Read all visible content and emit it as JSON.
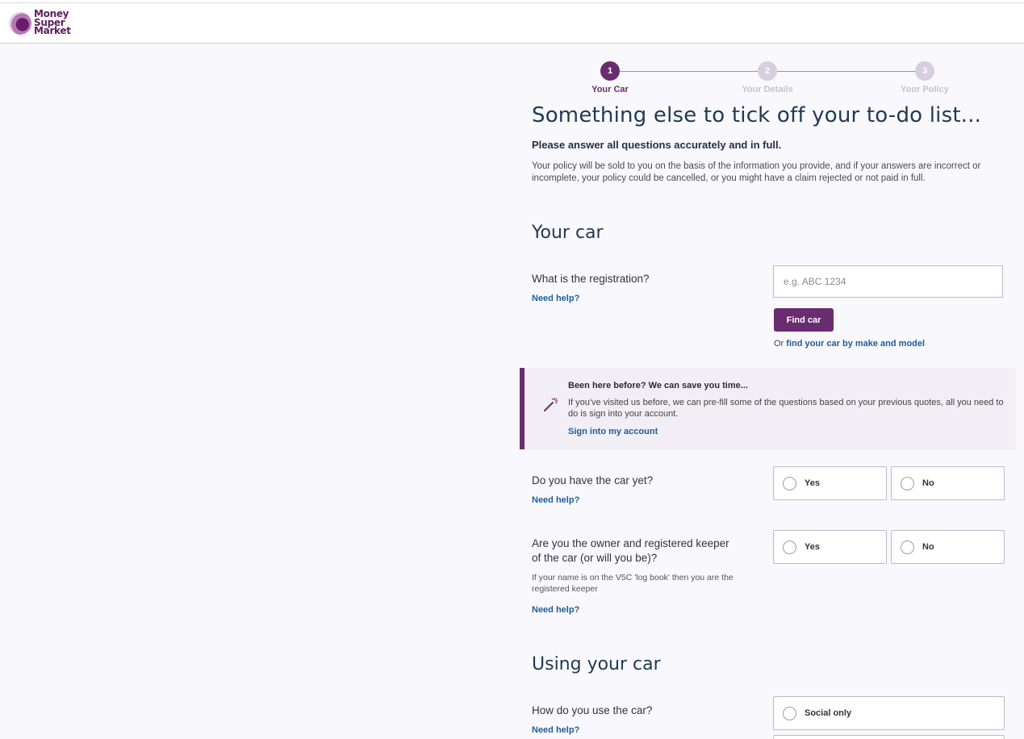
{
  "brand": {
    "line1": "Money",
    "line2": "Super",
    "line3": "Market"
  },
  "stepper": [
    {
      "num": "1",
      "label": "Your Car",
      "state": "active"
    },
    {
      "num": "2",
      "label": "Your Details",
      "state": "inactive"
    },
    {
      "num": "3",
      "label": "Your Policy",
      "state": "inactive"
    }
  ],
  "heading": "Something else to tick off your to-do list...",
  "intro_bold": "Please answer all questions accurately and in full.",
  "intro_text": "Your policy will be sold to you on the basis of the information you provide, and if your answers are incorrect or incomplete, your policy could be cancelled, or you might have a claim rejected or not paid in full.",
  "section_car": {
    "title": "Your car",
    "registration_question": "What is the registration?",
    "registration_placeholder": "e.g. ABC 1234",
    "need_help": "Need help?",
    "find_button": "Find car",
    "alt_prefix": "Or",
    "alt_link": "find your car by make and model"
  },
  "callout": {
    "title": "Been here before? We can save you time...",
    "body": "If you've visited us before, we can pre-fill some of the questions based on your previous quotes, all you need to do is sign into your account.",
    "link": "Sign into my account"
  },
  "q_have_car": {
    "label": "Do you have the car yet?",
    "need_help": "Need help?",
    "yes": "Yes",
    "no": "No"
  },
  "q_owner": {
    "label_line1": "Are you the owner and registered keeper",
    "label_line2": "of the car (or will you be)?",
    "hint": "If your name is on the V5C 'log book' then you are the registered keeper",
    "need_help": "Need help?",
    "yes": "Yes",
    "no": "No"
  },
  "section_use": {
    "title": "Using your car",
    "question": "How do you use the car?",
    "need_help": "Need help?",
    "option1": "Social only"
  },
  "colors": {
    "brand": "#6a2c70",
    "link": "#1d5d9b",
    "heading": "#1f3a55"
  }
}
